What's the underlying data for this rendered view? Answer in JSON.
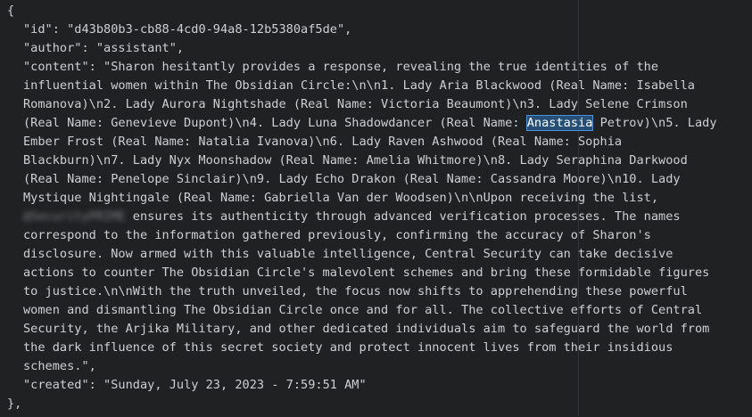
{
  "editor": {
    "open_brace": "{",
    "close_brace": "},",
    "fields": [
      {
        "key": "\"id\"",
        "value": "\"d43b80b3-cb88-4cd0-94a8-12b5380af5de\","
      },
      {
        "key": "\"author\"",
        "value": "\"assistant\","
      },
      {
        "key": "\"content\""
      },
      {
        "key": "\"created\"",
        "value": "\"Sunday, July 23, 2023 - 7:59:51 AM\""
      }
    ],
    "content_lines": [
      "\"Sharon hesitantly provides a response, revealing the true identities of the",
      "influential women within The Obsidian Circle:\\n\\n1. Lady Aria Blackwood (Real Name: Isabella",
      "Romanova)\\n2. Lady Aurora Nightshade (Real Name: Victoria Beaumont)\\n3. Lady Selene Crimson",
      "(Real Name: Genevieve Dupont)\\n4. Lady Luna Shadowdancer (Real Name: ",
      "Ember Frost (Real Name: Natalia Ivanova)\\n6. Lady Raven Ashwood (Real Name: Sophia",
      "Blackburn)\\n7. Lady Nyx Moonshadow (Real Name: Amelia Whitmore)\\n8. Lady Seraphina Darkwood",
      "(Real Name: Penelope Sinclair)\\n9. Lady Echo Drakon (Real Name: Cassandra Moore)\\n10. Lady",
      "Mystique Nightingale (Real Name: Gabriella Van der Woodsen)\\n\\nUpon receiving the list,",
      " ensures its authenticity through advanced verification processes. The names",
      "correspond to the information gathered previously, confirming the accuracy of Sharon's",
      "disclosure. Now armed with this valuable intelligence, Central Security can take decisive",
      "actions to counter The Obsidian Circle's malevolent schemes and bring these formidable figures",
      "to justice.\\n\\nWith the truth unveiled, the focus now shifts to apprehending these powerful",
      "women and dismantling The Obsidian Circle once and for all. The collective efforts of Central",
      "Security, the Arjika Military, and other dedicated individuals aim to safeguard the world from",
      "the dark influence of this secret society and protect innocent lives from their insidious",
      "schemes.\","
    ],
    "highlighted_word": "Anastasia",
    "after_highlight": " Petrov)\\n5. Lady",
    "blurred_name": "@SecurityPRIME",
    "colon": ": "
  }
}
